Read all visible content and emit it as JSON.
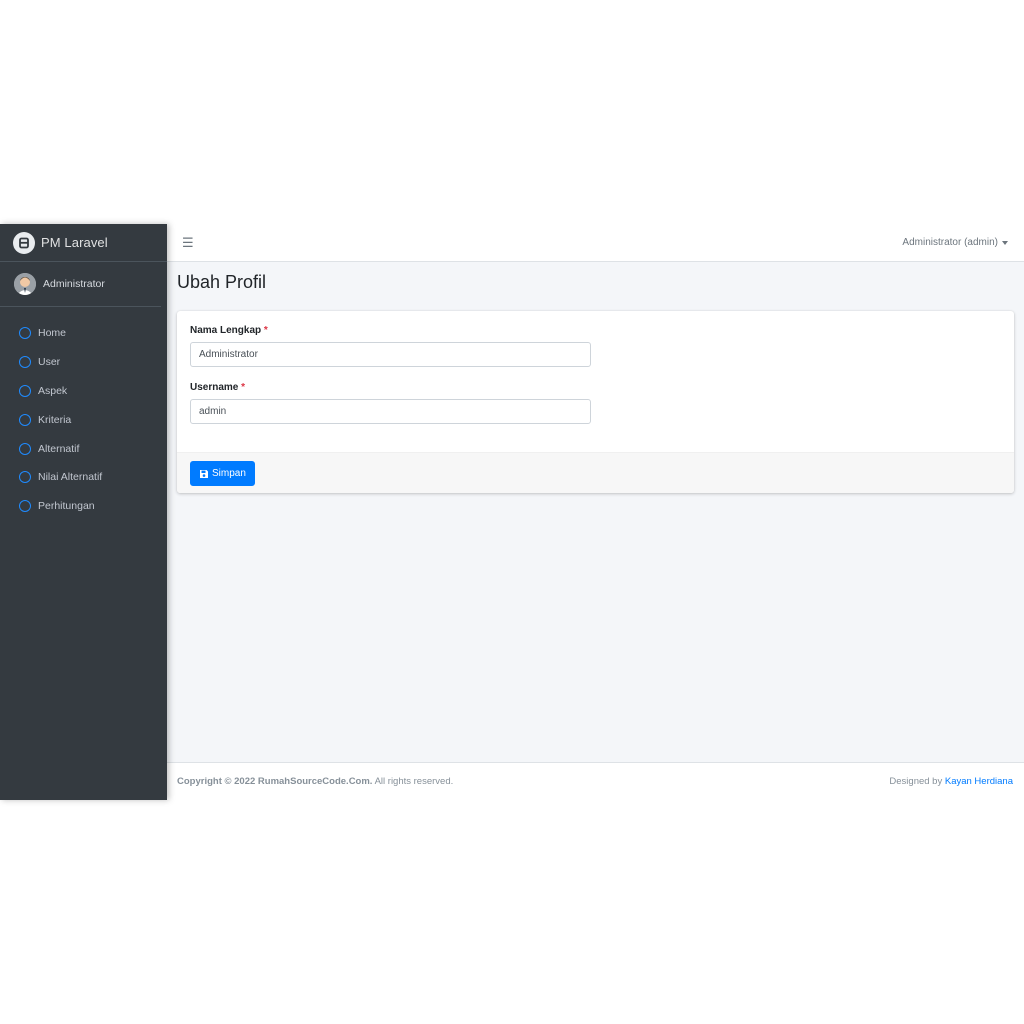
{
  "brand": {
    "name": "PM Laravel"
  },
  "user_panel": {
    "name": "Administrator"
  },
  "sidebar": {
    "items": [
      {
        "label": "Home"
      },
      {
        "label": "User"
      },
      {
        "label": "Aspek"
      },
      {
        "label": "Kriteria"
      },
      {
        "label": "Alternatif"
      },
      {
        "label": "Nilai Alternatif"
      },
      {
        "label": "Perhitungan"
      }
    ]
  },
  "topbar": {
    "menu_icon": "hamburger-icon",
    "user_menu": "Administrator (admin)"
  },
  "page": {
    "title": "Ubah Profil"
  },
  "form": {
    "nama_label": "Nama Lengkap",
    "nama_value": "Administrator",
    "username_label": "Username",
    "username_value": "admin",
    "required_mark": "*",
    "submit_label": "Simpan",
    "submit_icon": "save-icon"
  },
  "footer": {
    "copyright": "Copyright © 2022 RumahSourceCode.Com.",
    "rights": "All rights reserved.",
    "designed_by": "Designed by",
    "author": "Kayan Herdiana"
  },
  "colors": {
    "sidebar_bg": "#343a40",
    "accent": "#007bff",
    "required": "#dc3545",
    "content_bg": "#f4f6f9"
  }
}
